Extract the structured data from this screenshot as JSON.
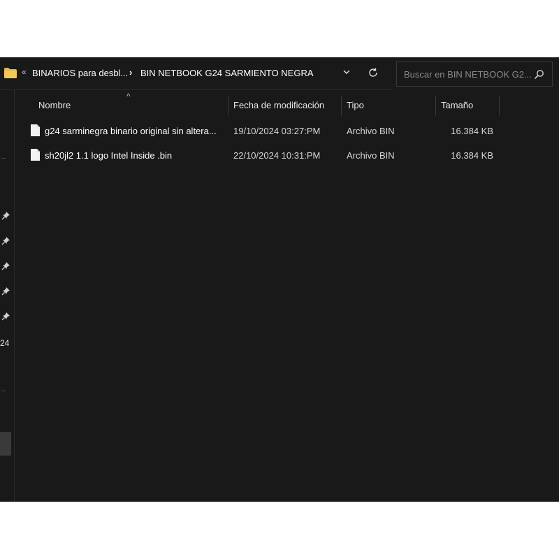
{
  "address_bar": {
    "overflow_chevron": "«",
    "crumbs": [
      "BINARIOS para desbl...",
      "BIN NETBOOK G24 SARMIENTO NEGRA"
    ],
    "separator": "›",
    "dropdown_icon": "chevron-down-icon",
    "refresh_icon": "refresh-icon",
    "folder_icon": "folder-icon"
  },
  "search": {
    "placeholder": "Buscar en BIN NETBOOK G2...",
    "icon": "search-icon"
  },
  "columns": {
    "name": "Nombre",
    "modified": "Fecha de modificación",
    "type": "Tipo",
    "size": "Tamaño",
    "sort_indicator": "^"
  },
  "files": [
    {
      "name": "g24 sarminegra binario original sin altera...",
      "modified": "19/10/2024 03:27:PM",
      "type": "Archivo BIN",
      "size": "16.384 KB"
    },
    {
      "name": "sh20jl2 1.1 logo Intel Inside .bin",
      "modified": "22/10/2024 10:31:PM",
      "type": "Archivo BIN",
      "size": "16.384 KB"
    }
  ],
  "nav_pane": {
    "visible_text": "24",
    "pin_icon": "pin-icon"
  },
  "colors": {
    "background": "#191919",
    "folder": "#e8b84a"
  }
}
